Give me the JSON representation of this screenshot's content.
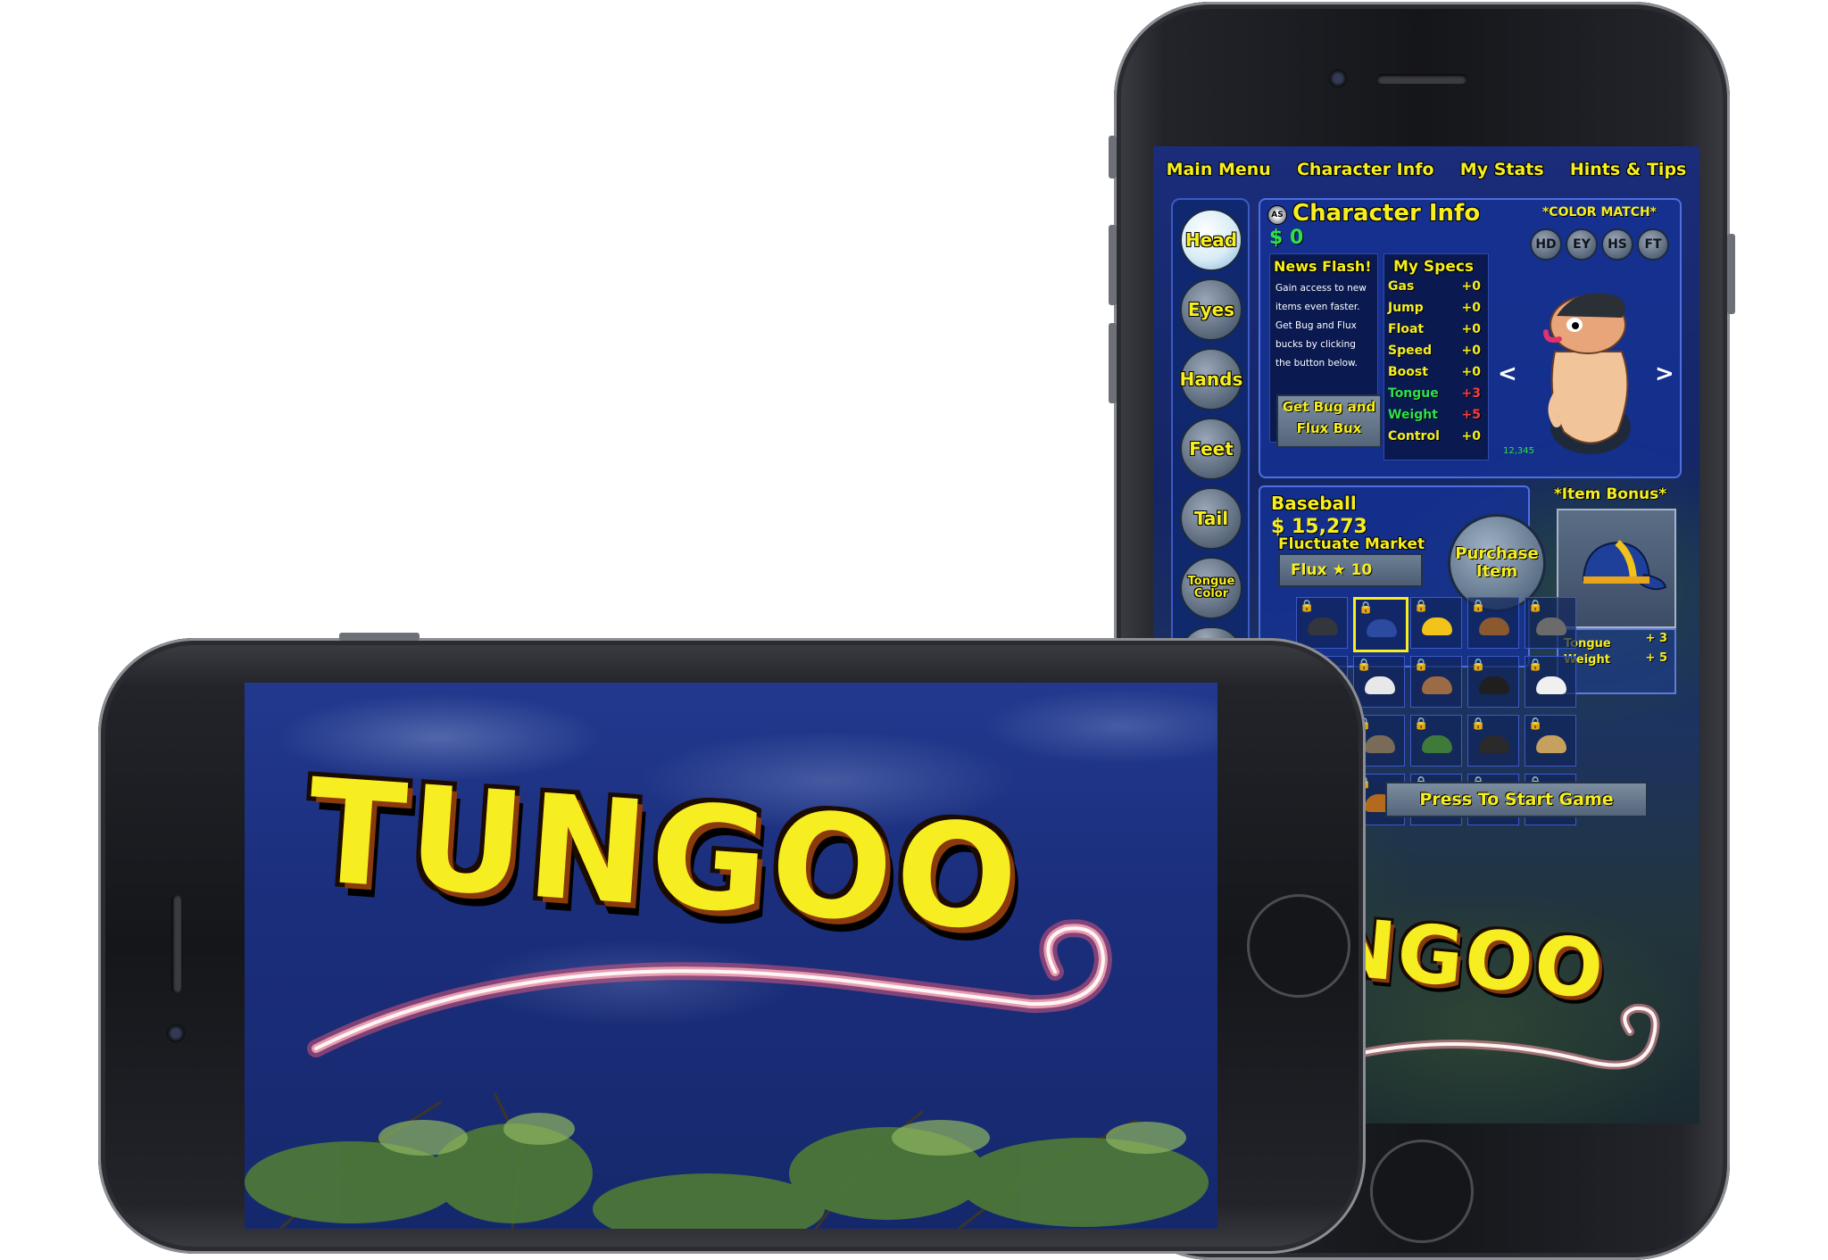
{
  "portrait": {
    "nav": [
      "Main Menu",
      "Character Info",
      "My Stats",
      "Hints & Tips"
    ],
    "side_buttons": [
      "Head",
      "Eyes",
      "Hands",
      "Feet",
      "Tail",
      "Tongue Color"
    ],
    "coin_icon": "AS",
    "panel_title": "Character Info",
    "balance": "$ 0",
    "color_match": {
      "label": "*COLOR MATCH*",
      "buttons": [
        "HD",
        "EY",
        "HS",
        "FT"
      ]
    },
    "news": {
      "title": "News Flash!",
      "text": "Gain access to new items even faster. Get Bug and Flux bucks by clicking the button below.",
      "button": "Get Bug and Flux Bux"
    },
    "specs": {
      "title": "My Specs",
      "rows": [
        {
          "name": "Gas",
          "value": "+0",
          "color": "#f6ee21",
          "value_color": "#f6ee21"
        },
        {
          "name": "Jump",
          "value": "+0",
          "color": "#f6ee21",
          "value_color": "#f6ee21"
        },
        {
          "name": "Float",
          "value": "+0",
          "color": "#f6ee21",
          "value_color": "#f6ee21"
        },
        {
          "name": "Speed",
          "value": "+0",
          "color": "#f6ee21",
          "value_color": "#f6ee21"
        },
        {
          "name": "Boost",
          "value": "+0",
          "color": "#f6ee21",
          "value_color": "#f6ee21"
        },
        {
          "name": "Tongue",
          "value": "+3",
          "color": "#2fe04b",
          "value_color": "#ff3b3b"
        },
        {
          "name": "Weight",
          "value": "+5",
          "color": "#2fe04b",
          "value_color": "#ff3b3b"
        },
        {
          "name": "Control",
          "value": "+0",
          "color": "#f6ee21",
          "value_color": "#f6ee21"
        }
      ]
    },
    "character_counter": "12,345",
    "arrows": {
      "left": "<",
      "right": ">"
    },
    "item": {
      "name": "Baseball",
      "price": "$ 15,273",
      "market_label": "Fluctuate Market",
      "flux": "Flux ★ 10",
      "purchase": "Purchase Item"
    },
    "item_bonus": {
      "title": "*Item Bonus*",
      "lines": [
        {
          "name": "Tongue",
          "value": "+ 3"
        },
        {
          "name": "Weight",
          "value": "+ 5"
        }
      ]
    },
    "grid_hat_colors": [
      "#33363c",
      "#2b4aa0",
      "#f2c318",
      "#8a5a2e",
      "#6b6b6b",
      "#8a5a2e",
      "#e8e8e8",
      "#9a6b44",
      "#1f1f1f",
      "#f0f0f0",
      "#6b6b6b",
      "#7a6a58",
      "#3e7a3a",
      "#2a2a2a",
      "#c6a15d",
      "#cc3b3b",
      "#b36a1c",
      "#3c8a3c",
      "#202020",
      "#e0e0e0"
    ],
    "start": "Press To Start Game",
    "logo": "NGOO"
  },
  "landscape": {
    "logo": "TUNGOO"
  },
  "colors": {
    "accent_yellow": "#f6ee21",
    "green": "#2fe04b",
    "red": "#ff3b3b",
    "panel_blue": "#1432a0"
  }
}
